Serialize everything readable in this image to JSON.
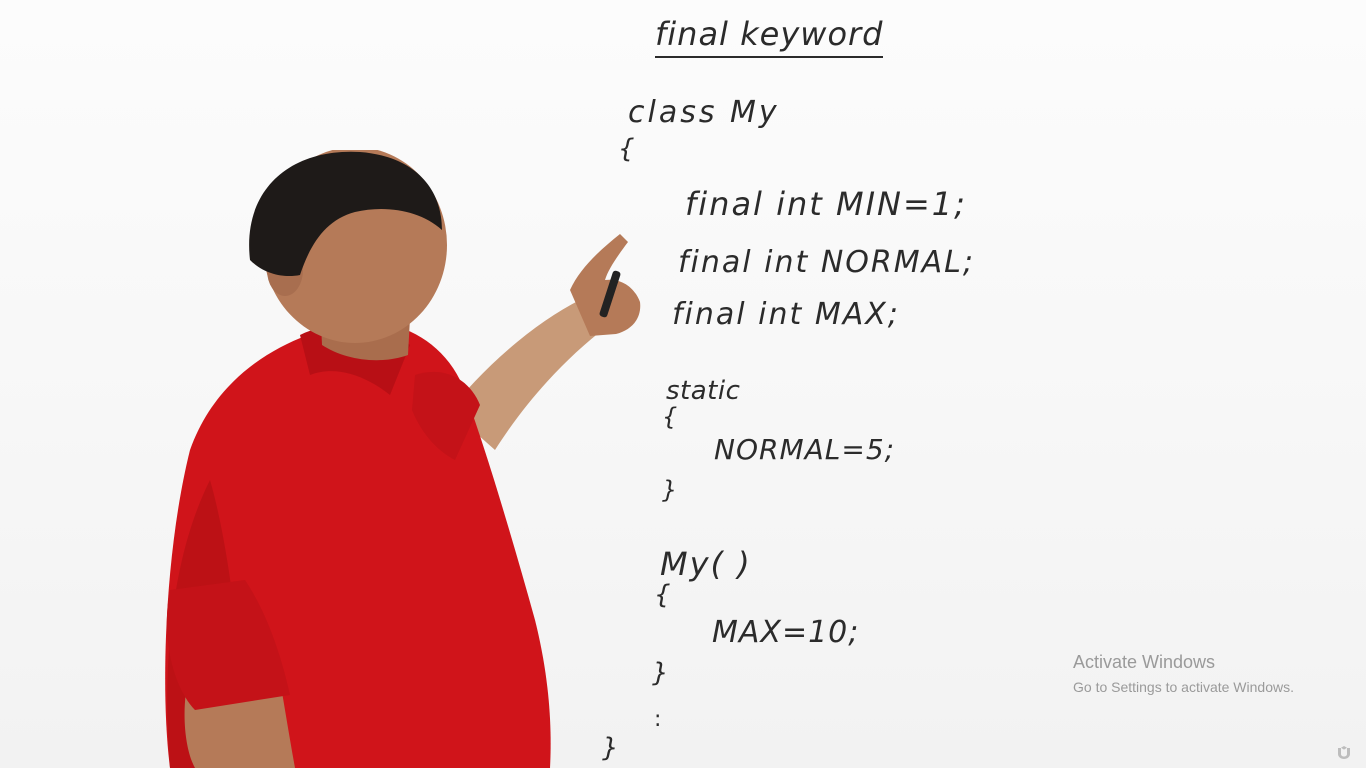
{
  "board": {
    "title": "final keyword",
    "class_decl": "class My",
    "brace_open": "{",
    "brace_close": "}",
    "line_min": "final int MIN=1;",
    "line_normal": "final int NORMAL;",
    "line_max": "final int MAX;",
    "static_label": "static",
    "normal_assign": "NORMAL=5;",
    "ctor_label": "My( )",
    "max_assign": "MAX=10;",
    "dots": ":"
  },
  "watermark": {
    "title": "Activate Windows",
    "subtitle": "Go to Settings to activate Windows."
  },
  "colors": {
    "shirt": "#d0141a",
    "skin": "#b57a58",
    "hair": "#1e1a18",
    "ink": "#2b2b2b"
  },
  "icons": {
    "logo": "video-logo-icon"
  }
}
